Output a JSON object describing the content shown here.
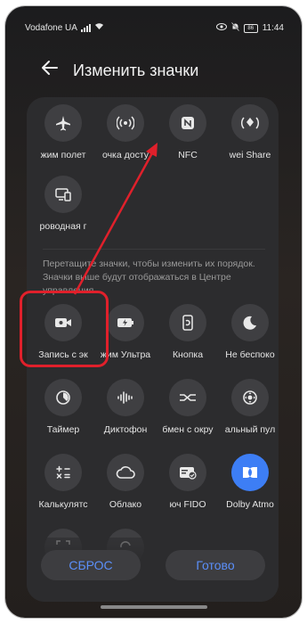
{
  "status_bar": {
    "carrier": "Vodafone UA",
    "time": "11:44",
    "battery": "86"
  },
  "header": {
    "title": "Изменить значки"
  },
  "active_tiles": [
    {
      "label": "жим полет",
      "icon": "airplane-icon"
    },
    {
      "label": "очка досту",
      "icon": "hotspot-icon"
    },
    {
      "label": "NFC",
      "icon": "nfc-icon"
    },
    {
      "label": "wei Share",
      "icon": "share-icon"
    },
    {
      "label": "роводная г",
      "icon": "wireless-projection-icon"
    }
  ],
  "hint": "Перетащите значки, чтобы изменить их порядок. Значки выше будут отображаться в Центре управления.",
  "available_tiles": [
    {
      "label": "Запись с эк",
      "icon": "screen-record-icon"
    },
    {
      "label": "жим Ультра",
      "icon": "ultra-battery-icon"
    },
    {
      "label": "Кнопка",
      "icon": "button-icon"
    },
    {
      "label": "Не беспоко",
      "icon": "moon-icon"
    },
    {
      "label": "Таймер",
      "icon": "timer-icon"
    },
    {
      "label": "Диктофон",
      "icon": "voice-recorder-icon"
    },
    {
      "label": "бмен с окру",
      "icon": "nearby-share-icon"
    },
    {
      "label": "альный пул",
      "icon": "remote-control-icon"
    },
    {
      "label": "Калькулятс",
      "icon": "calculator-icon"
    },
    {
      "label": "Облако",
      "icon": "cloud-icon"
    },
    {
      "label": "юч FIDO",
      "icon": "fido-key-icon"
    },
    {
      "label": "Dolby Atmo",
      "icon": "dolby-icon"
    }
  ],
  "buttons": {
    "reset": "СБРОС",
    "done": "Готово"
  },
  "colors": {
    "accent": "#5b8ff9",
    "highlight": "#e0202b",
    "dolby": "#3d7ef5"
  }
}
